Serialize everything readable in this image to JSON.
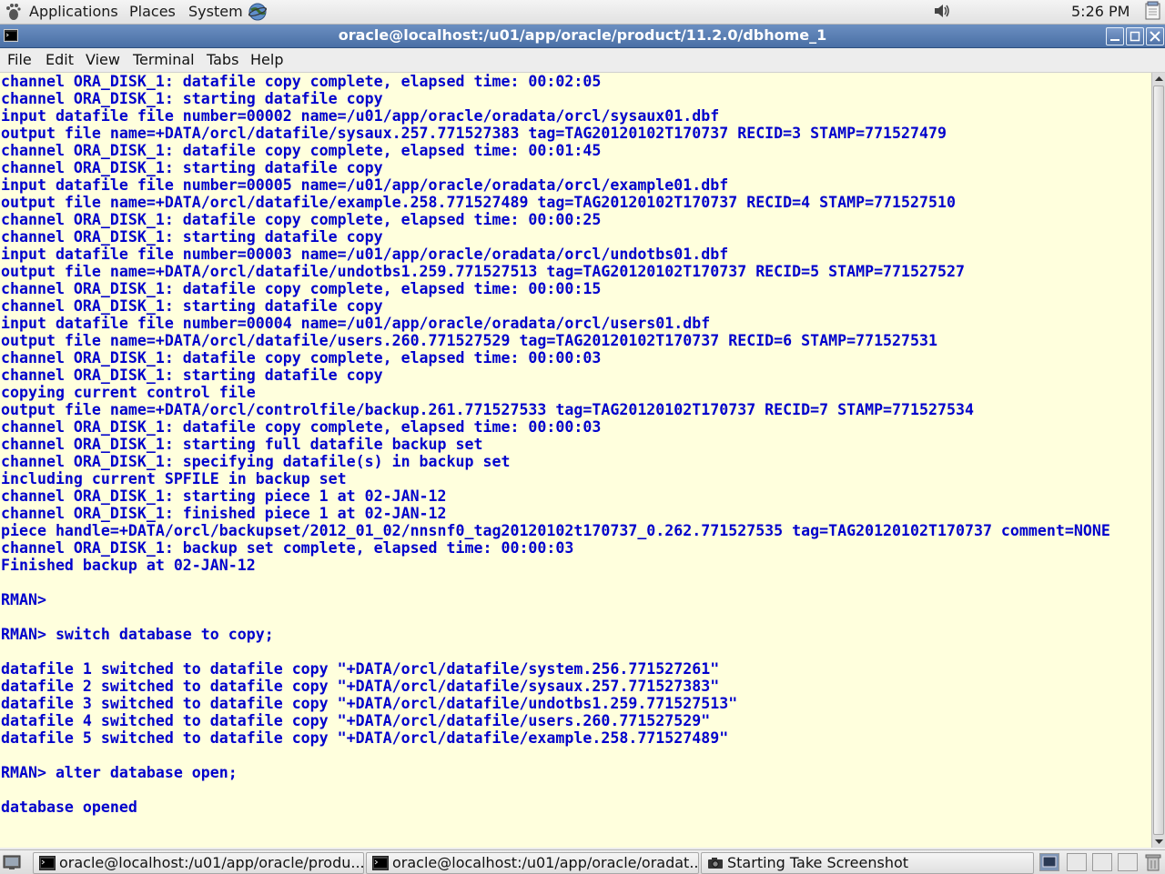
{
  "top_panel": {
    "menus": [
      "Applications",
      "Places",
      "System"
    ],
    "clock": "5:26 PM"
  },
  "window": {
    "title": "oracle@localhost:/u01/app/oracle/product/11.2.0/dbhome_1"
  },
  "menubar": {
    "items": [
      "File",
      "Edit",
      "View",
      "Terminal",
      "Tabs",
      "Help"
    ]
  },
  "terminal": {
    "lines": [
      "channel ORA_DISK_1: datafile copy complete, elapsed time: 00:02:05",
      "channel ORA_DISK_1: starting datafile copy",
      "input datafile file number=00002 name=/u01/app/oracle/oradata/orcl/sysaux01.dbf",
      "output file name=+DATA/orcl/datafile/sysaux.257.771527383 tag=TAG20120102T170737 RECID=3 STAMP=771527479",
      "channel ORA_DISK_1: datafile copy complete, elapsed time: 00:01:45",
      "channel ORA_DISK_1: starting datafile copy",
      "input datafile file number=00005 name=/u01/app/oracle/oradata/orcl/example01.dbf",
      "output file name=+DATA/orcl/datafile/example.258.771527489 tag=TAG20120102T170737 RECID=4 STAMP=771527510",
      "channel ORA_DISK_1: datafile copy complete, elapsed time: 00:00:25",
      "channel ORA_DISK_1: starting datafile copy",
      "input datafile file number=00003 name=/u01/app/oracle/oradata/orcl/undotbs01.dbf",
      "output file name=+DATA/orcl/datafile/undotbs1.259.771527513 tag=TAG20120102T170737 RECID=5 STAMP=771527527",
      "channel ORA_DISK_1: datafile copy complete, elapsed time: 00:00:15",
      "channel ORA_DISK_1: starting datafile copy",
      "input datafile file number=00004 name=/u01/app/oracle/oradata/orcl/users01.dbf",
      "output file name=+DATA/orcl/datafile/users.260.771527529 tag=TAG20120102T170737 RECID=6 STAMP=771527531",
      "channel ORA_DISK_1: datafile copy complete, elapsed time: 00:00:03",
      "channel ORA_DISK_1: starting datafile copy",
      "copying current control file",
      "output file name=+DATA/orcl/controlfile/backup.261.771527533 tag=TAG20120102T170737 RECID=7 STAMP=771527534",
      "channel ORA_DISK_1: datafile copy complete, elapsed time: 00:00:03",
      "channel ORA_DISK_1: starting full datafile backup set",
      "channel ORA_DISK_1: specifying datafile(s) in backup set",
      "including current SPFILE in backup set",
      "channel ORA_DISK_1: starting piece 1 at 02-JAN-12",
      "channel ORA_DISK_1: finished piece 1 at 02-JAN-12",
      "piece handle=+DATA/orcl/backupset/2012_01_02/nnsnf0_tag20120102t170737_0.262.771527535 tag=TAG20120102T170737 comment=NONE",
      "channel ORA_DISK_1: backup set complete, elapsed time: 00:00:03",
      "Finished backup at 02-JAN-12",
      "",
      "RMAN>",
      "",
      "RMAN> switch database to copy;",
      "",
      "datafile 1 switched to datafile copy \"+DATA/orcl/datafile/system.256.771527261\"",
      "datafile 2 switched to datafile copy \"+DATA/orcl/datafile/sysaux.257.771527383\"",
      "datafile 3 switched to datafile copy \"+DATA/orcl/datafile/undotbs1.259.771527513\"",
      "datafile 4 switched to datafile copy \"+DATA/orcl/datafile/users.260.771527529\"",
      "datafile 5 switched to datafile copy \"+DATA/orcl/datafile/example.258.771527489\"",
      "",
      "RMAN> alter database open;",
      "",
      "database opened"
    ],
    "text_color": "#0000cc",
    "background": "#ffffdd"
  },
  "taskbar": {
    "tasks": [
      {
        "label": "oracle@localhost:/u01/app/oracle/produ...",
        "icon": "terminal-icon"
      },
      {
        "label": "oracle@localhost:/u01/app/oracle/oradat...",
        "icon": "terminal-icon"
      },
      {
        "label": "Starting Take Screenshot",
        "icon": "camera-icon"
      }
    ]
  },
  "colors": {
    "titlebar": "#4a6fa5",
    "panel": "#ededed"
  }
}
